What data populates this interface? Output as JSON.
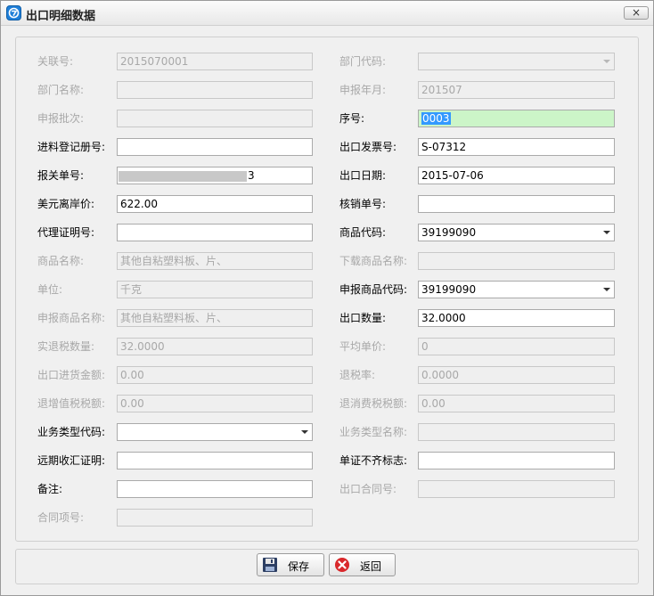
{
  "window": {
    "title": "出口明细数据",
    "close_label": "×"
  },
  "left": [
    {
      "label": "关联号:",
      "value": "2015070001",
      "disabled": true
    },
    {
      "label": "部门名称:",
      "value": "",
      "disabled": true
    },
    {
      "label": "申报批次:",
      "value": "",
      "disabled": true
    },
    {
      "label": "进料登记册号:",
      "value": "",
      "disabled": false
    },
    {
      "label": "报关单号:",
      "value": "3",
      "disabled": false,
      "masked": true
    },
    {
      "label": "美元离岸价:",
      "value": "622.00",
      "disabled": false
    },
    {
      "label": "代理证明号:",
      "value": "",
      "disabled": false
    },
    {
      "label": "商品名称:",
      "value": "其他自粘塑料板、片、",
      "disabled": true
    },
    {
      "label": "单位:",
      "value": "千克",
      "disabled": true
    },
    {
      "label": "申报商品名称:",
      "value": "其他自粘塑料板、片、",
      "disabled": true
    },
    {
      "label": "实退税数量:",
      "value": "32.0000",
      "disabled": true
    },
    {
      "label": "出口进货金额:",
      "value": "0.00",
      "disabled": true
    },
    {
      "label": "退增值税税额:",
      "value": "0.00",
      "disabled": true
    },
    {
      "label": "业务类型代码:",
      "value": "",
      "disabled": false,
      "dropdown": true
    },
    {
      "label": "远期收汇证明:",
      "value": "",
      "disabled": false
    },
    {
      "label": "备注:",
      "value": "",
      "disabled": false
    },
    {
      "label": "合同项号:",
      "value": "",
      "disabled": true
    }
  ],
  "right": [
    {
      "label": "部门代码:",
      "value": "",
      "disabled": true,
      "dropdown": true
    },
    {
      "label": "申报年月:",
      "value": "201507",
      "disabled": true
    },
    {
      "label": "序号:",
      "value": "0003",
      "disabled": false,
      "highlight": true
    },
    {
      "label": "出口发票号:",
      "value": "S-07312",
      "disabled": false
    },
    {
      "label": "出口日期:",
      "value": "2015-07-06",
      "disabled": false
    },
    {
      "label": "核销单号:",
      "value": "",
      "disabled": false
    },
    {
      "label": "商品代码:",
      "value": "39199090",
      "disabled": false,
      "dropdown": true
    },
    {
      "label": "下载商品名称:",
      "value": "",
      "disabled": true
    },
    {
      "label": "申报商品代码:",
      "value": "39199090",
      "disabled": false,
      "dropdown": true
    },
    {
      "label": "出口数量:",
      "value": "32.0000",
      "disabled": false
    },
    {
      "label": "平均单价:",
      "value": "0",
      "disabled": true
    },
    {
      "label": "退税率:",
      "value": "0.0000",
      "disabled": true
    },
    {
      "label": "退消费税税额:",
      "value": "0.00",
      "disabled": true
    },
    {
      "label": "业务类型名称:",
      "value": "",
      "disabled": true
    },
    {
      "label": "单证不齐标志:",
      "value": "",
      "disabled": false
    },
    {
      "label": "出口合同号:",
      "value": "",
      "disabled": true
    }
  ],
  "buttons": {
    "save": "保存",
    "back": "返回"
  }
}
